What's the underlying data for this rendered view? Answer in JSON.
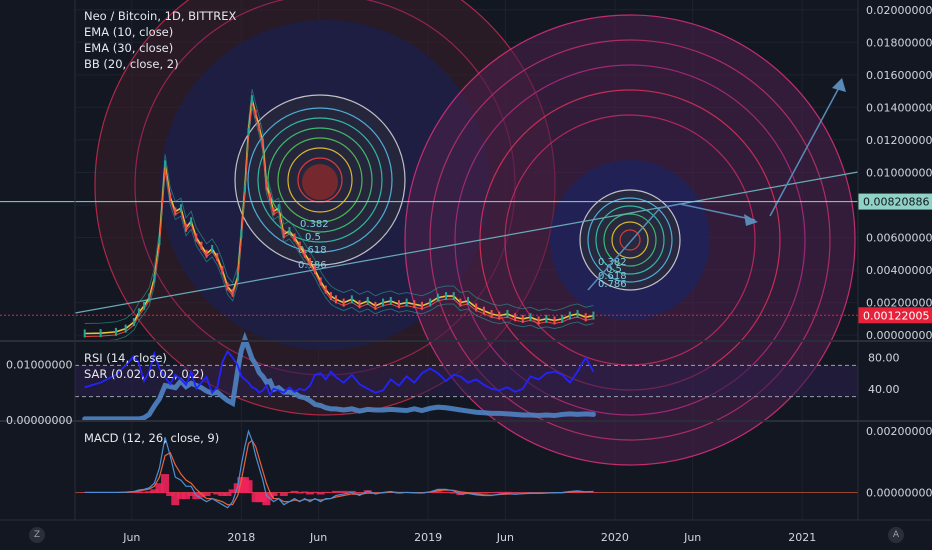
{
  "header": {
    "title": "Neo / Bitcoin, 1D, BITTREX",
    "indicators": [
      "EMA (10, close)",
      "EMA (30, close)",
      "BB (20, close, 2)"
    ]
  },
  "rsi_panel": {
    "legend": [
      "RSI (14, close)",
      "SAR (0.02, 0.02, 0.2)"
    ]
  },
  "macd_panel": {
    "legend": [
      "MACD (12, 26, close, 9)"
    ]
  },
  "controls": {
    "zoom_label": "Z",
    "auto_label": "A"
  },
  "colors": {
    "background": "#131722",
    "grid": "#1e2230",
    "price_label_cyan": "#8fd3c4",
    "price_label_red": "#e8213a",
    "rsi_line": "#2323ff",
    "sar": "#4f84c4",
    "macd_line": "#4c8fd6",
    "signal_line": "#e8633a",
    "histogram": "#f0235a"
  },
  "chart_data": [
    {
      "type": "line",
      "title": "Neo / Bitcoin, 1D, BITTREX",
      "x_tick_labels": [
        "Jun",
        "2018",
        "Jun",
        "2019",
        "Jun",
        "2020",
        "Jun",
        "2021"
      ],
      "y_tick_labels": [
        "0.02000000",
        "0.01800000",
        "0.01600000",
        "0.01400000",
        "0.01200000",
        "0.01000000",
        "0.00800000",
        "0.00600000",
        "0.00400000",
        "0.00200000",
        "0.00000000"
      ],
      "ylim": [
        -0.0003,
        0.0206
      ],
      "price_labels": [
        {
          "value": 0.00820886,
          "text": "0.00820886",
          "color": "#8fd3c4"
        },
        {
          "value": 0.00122005,
          "text": "0.00122005",
          "color": "#e8213a"
        }
      ],
      "fib_labels": [
        "0.382",
        "0.5",
        "0.618",
        "0.786"
      ],
      "series": [
        {
          "x": [
            "2017-03-01",
            "2017-04-01",
            "2017-05-01",
            "2017-05-20",
            "2017-06-05",
            "2017-06-15",
            "2017-06-25",
            "2017-07-05",
            "2017-07-15",
            "2017-07-25",
            "2017-08-05",
            "2017-08-15",
            "2017-08-25",
            "2017-09-05",
            "2017-09-15",
            "2017-09-25",
            "2017-10-05",
            "2017-10-15",
            "2017-10-25",
            "2017-11-05",
            "2017-11-15",
            "2017-11-25",
            "2017-12-05",
            "2017-12-15",
            "2017-12-25",
            "2018-01-01",
            "2018-01-08",
            "2018-01-15",
            "2018-01-22",
            "2018-01-29",
            "2018-02-05",
            "2018-02-12",
            "2018-02-19",
            "2018-02-26",
            "2018-03-05",
            "2018-03-15",
            "2018-03-25",
            "2018-04-05",
            "2018-04-15",
            "2018-04-25",
            "2018-05-05",
            "2018-05-15",
            "2018-05-25",
            "2018-06-05",
            "2018-06-15",
            "2018-06-25",
            "2018-07-05",
            "2018-07-20",
            "2018-08-05",
            "2018-08-20",
            "2018-09-05",
            "2018-09-20",
            "2018-10-05",
            "2018-10-20",
            "2018-11-05",
            "2018-11-20",
            "2018-12-05",
            "2018-12-20",
            "2019-01-05",
            "2019-01-20",
            "2019-02-05",
            "2019-02-20",
            "2019-03-05",
            "2019-03-20",
            "2019-04-05",
            "2019-04-20",
            "2019-05-05",
            "2019-05-20",
            "2019-06-05",
            "2019-06-20",
            "2019-07-05",
            "2019-07-20",
            "2019-08-05",
            "2019-08-20",
            "2019-09-05",
            "2019-09-20",
            "2019-10-05",
            "2019-10-20",
            "2019-11-05",
            "2019-11-20"
          ],
          "y": [
            0.0001,
            0.00012,
            0.0002,
            0.0004,
            0.0008,
            0.0014,
            0.0018,
            0.0023,
            0.0035,
            0.0058,
            0.0105,
            0.0085,
            0.0076,
            0.0078,
            0.0066,
            0.007,
            0.006,
            0.0055,
            0.005,
            0.0053,
            0.0048,
            0.004,
            0.003,
            0.0026,
            0.0036,
            0.0062,
            0.009,
            0.0125,
            0.0145,
            0.0136,
            0.0128,
            0.0118,
            0.0092,
            0.0085,
            0.0076,
            0.0078,
            0.0062,
            0.0064,
            0.006,
            0.0055,
            0.005,
            0.0045,
            0.004,
            0.0033,
            0.0028,
            0.0024,
            0.0022,
            0.002,
            0.0022,
            0.0019,
            0.0021,
            0.0018,
            0.002,
            0.0021,
            0.0019,
            0.002,
            0.0019,
            0.0018,
            0.002,
            0.0023,
            0.0024,
            0.0024,
            0.002,
            0.0021,
            0.0017,
            0.0015,
            0.0013,
            0.0012,
            0.0013,
            0.0011,
            0.001,
            0.0011,
            0.0009,
            0.001,
            0.0009,
            0.001,
            0.0012,
            0.0013,
            0.0011,
            0.0012
          ]
        }
      ]
    },
    {
      "type": "line",
      "title": "RSI (14, close)",
      "y_tick_labels": [
        "80.00",
        "40.00"
      ],
      "ylim": [
        0,
        100
      ],
      "levels": [
        70,
        30
      ],
      "left_tick_labels": [
        "0.01000000",
        "0.00000000"
      ],
      "series": [
        {
          "name": "RSI",
          "y": [
            42,
            48,
            58,
            70,
            82,
            72,
            50,
            62,
            85,
            66,
            55,
            46,
            58,
            52,
            45,
            62,
            40,
            48,
            55,
            35,
            42,
            74,
            88,
            80,
            70,
            56,
            52,
            48,
            42,
            40,
            35,
            38,
            44,
            32,
            40,
            38,
            35,
            42,
            36,
            40,
            38,
            44,
            58,
            60,
            52,
            62,
            55,
            48,
            58,
            46,
            40,
            35,
            38,
            52,
            44,
            56,
            48,
            60,
            66,
            60,
            50,
            58,
            56,
            48,
            52,
            45,
            40,
            38,
            42,
            36,
            40,
            56,
            52,
            60,
            62,
            58,
            48,
            62,
            80,
            62
          ]
        },
        {
          "name": "SAR",
          "y": [
            0.0002,
            0.0002,
            0.0002,
            0.0002,
            0.0002,
            0.0002,
            0.0004,
            0.001,
            0.0025,
            0.0038,
            0.0062,
            0.006,
            0.0058,
            0.007,
            0.006,
            0.0066,
            0.0062,
            0.0058,
            0.0052,
            0.0048,
            0.005,
            0.0042,
            0.0035,
            0.003,
            0.009,
            0.0125,
            0.0145,
            0.0128,
            0.011,
            0.01,
            0.0085,
            0.0078,
            0.0068,
            0.007,
            0.0055,
            0.0058,
            0.005,
            0.005,
            0.0048,
            0.0042,
            0.004,
            0.0035,
            0.0028,
            0.0026,
            0.0022,
            0.002,
            0.002,
            0.0018,
            0.002,
            0.0016,
            0.0019,
            0.0018,
            0.0018,
            0.0019,
            0.0018,
            0.0017,
            0.002,
            0.0017,
            0.0021,
            0.0023,
            0.0022,
            0.002,
            0.0018,
            0.0016,
            0.0014,
            0.0013,
            0.0012,
            0.0012,
            0.0011,
            0.001,
            0.0009,
            0.0009,
            0.0008,
            0.0009,
            0.0008,
            0.001,
            0.0011,
            0.001,
            0.0011,
            0.001
          ]
        }
      ]
    },
    {
      "type": "line",
      "title": "MACD (12, 26, close, 9)",
      "y_tick_labels": [
        "0.00200000",
        "0.00000000"
      ],
      "ylim": [
        -0.0009,
        0.0023
      ],
      "series": [
        {
          "name": "MACD",
          "y": [
            0,
            0,
            0,
            1e-05,
            3e-05,
            8e-05,
            0.0001,
            0.00015,
            0.0003,
            0.0008,
            0.0018,
            0.0012,
            0.0005,
            0.0004,
            0.0002,
            0.0002,
            -0.0001,
            -0.0002,
            -0.0003,
            -0.0002,
            -0.0003,
            -0.0004,
            -0.0005,
            -0.0003,
            0.0002,
            0.0009,
            0.0015,
            0.002,
            0.0017,
            0.0012,
            0.0008,
            0.0004,
            -0.0001,
            -0.0002,
            -0.0003,
            -0.0002,
            -0.0004,
            -0.0003,
            -0.0002,
            -0.0003,
            -0.0002,
            -0.0003,
            -0.0002,
            -0.0003,
            -0.0002,
            -0.0002,
            -0.0001,
            -5e-05,
            0,
            -0.0001,
            5e-05,
            -5e-05,
            0,
            3e-05,
            -2e-05,
            0,
            -1e-05,
            -2e-05,
            2e-05,
            0.0001,
            0.0001,
            5e-05,
            -5e-05,
            -3e-05,
            -8e-05,
            -0.0001,
            -0.0001,
            -5e-05,
            -3e-05,
            -6e-05,
            -4e-05,
            -2e-05,
            -3e-05,
            -2e-05,
            -1e-05,
            0,
            3e-05,
            5e-05,
            2e-05,
            3e-05
          ]
        },
        {
          "name": "Signal",
          "y": [
            0,
            0,
            0,
            0,
            2e-05,
            5e-05,
            8e-05,
            0.00011,
            0.0002,
            0.0005,
            0.0012,
            0.0013,
            0.0009,
            0.0006,
            0.0004,
            0.0003,
            0.0001,
            -5e-05,
            -0.0002,
            -0.0002,
            -0.00025,
            -0.0003,
            -0.0004,
            -0.0004,
            -0.0001,
            0.0004,
            0.001,
            0.0016,
            0.0017,
            0.0015,
            0.0011,
            0.0007,
            0.0003,
            0,
            -0.0002,
            -0.0002,
            -0.0003,
            -0.0003,
            -0.00025,
            -0.00028,
            -0.00023,
            -0.00025,
            -0.00022,
            -0.00025,
            -0.00022,
            -0.0002,
            -0.00015,
            -0.0001,
            -5e-05,
            -7e-05,
            -2e-05,
            -3e-05,
            -1e-05,
            1e-05,
            0,
            0,
            -1e-05,
            -1e-05,
            1e-05,
            6e-05,
            8e-05,
            7e-05,
            2e-05,
            -1e-05,
            -5e-05,
            -8e-05,
            -9e-05,
            -7e-05,
            -5e-05,
            -5e-05,
            -4e-05,
            -3e-05,
            -3e-05,
            -2e-05,
            -1e-05,
            -1e-05,
            1e-05,
            3e-05,
            2e-05,
            3e-05
          ]
        }
      ]
    }
  ]
}
